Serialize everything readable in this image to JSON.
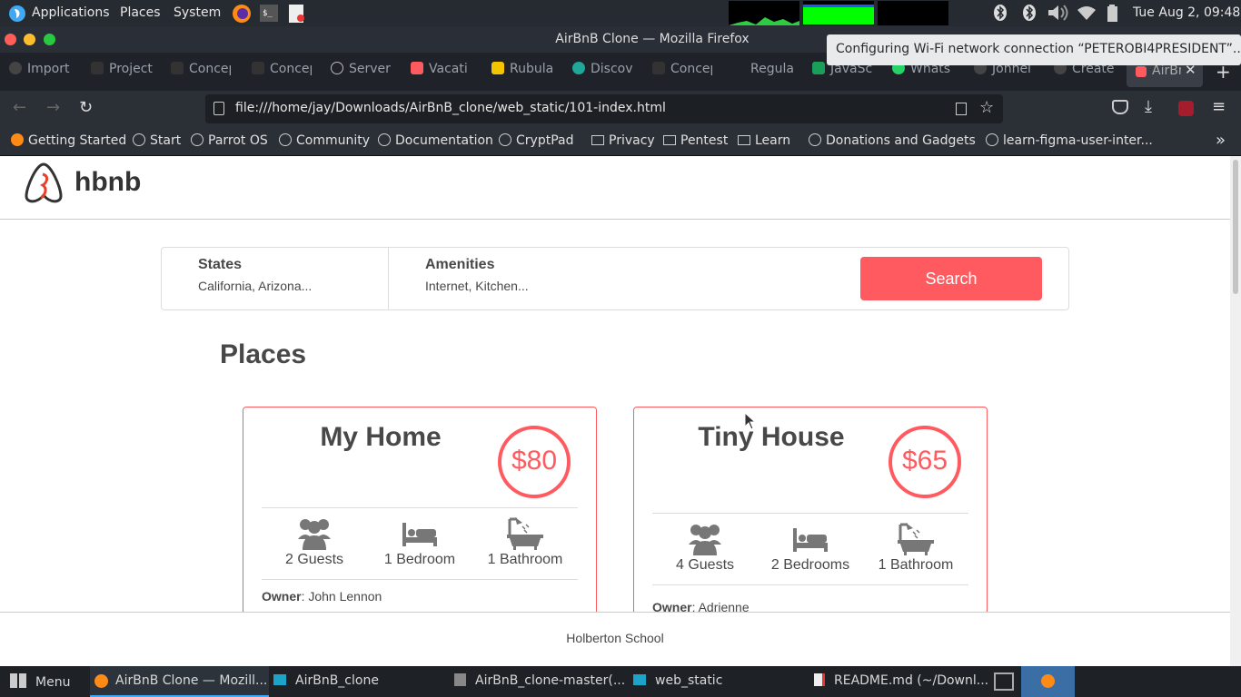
{
  "os_panel": {
    "menus": [
      "Applications",
      "Places",
      "System"
    ],
    "clock": "Tue Aug 2, 09:48"
  },
  "firefox": {
    "window_title": "AirBnB Clone — Mozilla Firefox",
    "tabs": [
      "Import",
      "Project",
      "Concep",
      "Concep",
      "Server",
      "Vacati",
      "Rubula",
      "Discov",
      "Concep",
      "Regula",
      "JavaSc",
      "Whats",
      "Johnel",
      "Create",
      "AirBn"
    ],
    "url": "file:///home/jay/Downloads/AirBnB_clone/web_static/101-index.html",
    "bookmarks": [
      "Getting Started",
      "Start",
      "Parrot OS",
      "Community",
      "Documentation",
      "CryptPad",
      "Privacy",
      "Pentest",
      "Learn",
      "Donations and Gadgets",
      "learn-figma-user-inter..."
    ],
    "notification": "Configuring Wi-Fi network connection “PETEROBI4PRESIDENT”..."
  },
  "page": {
    "logo_text": "hbnb",
    "filters": {
      "states_label": "States",
      "states_value": "California, Arizona...",
      "amenities_label": "Amenities",
      "amenities_value": "Internet, Kitchen...",
      "search_label": "Search"
    },
    "places_title": "Places",
    "places": [
      {
        "name": "My Home",
        "price": "$80",
        "guests": "2 Guests",
        "bedrooms": "1 Bedroom",
        "bathrooms": "1 Bathroom",
        "owner_label": "Owner",
        "owner": ": John Lennon"
      },
      {
        "name": "Tiny House",
        "price": "$65",
        "guests": "4 Guests",
        "bedrooms": "2 Bedrooms",
        "bathrooms": "1 Bathroom",
        "owner_label": "Owner",
        "owner": ": Adrienne"
      }
    ],
    "footer": "Holberton School"
  },
  "taskbar": {
    "menu_label": "Menu",
    "items": [
      "AirBnB Clone — Mozill...",
      "AirBnB_clone",
      "AirBnB_clone-master(...",
      "web_static",
      "README.md (~/Downl..."
    ]
  },
  "colors": {
    "accent": "#ff5a5f",
    "text": "#484848"
  }
}
